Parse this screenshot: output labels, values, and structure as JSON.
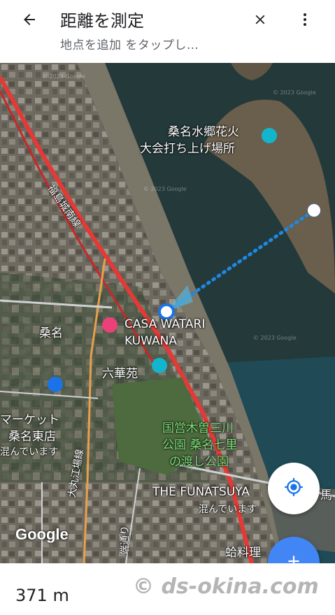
{
  "header": {
    "title": "距離を測定",
    "subtitle": "地点を追加 をタップし…"
  },
  "map": {
    "labels": {
      "fireworks_line1": "桑名水郷花火",
      "fireworks_line2": "大会打ち上げ場所",
      "road": "福島城南線",
      "kuwana": "桑名",
      "hotel_line1": "CASA WATARI",
      "hotel_line2": "KUWANA",
      "rikkaen": "六華苑",
      "park_line1": "国営木曽三川",
      "park_line2": "公園 桑名七里",
      "park_line3": "の渡し公園",
      "market_line1": "マーケット",
      "market_line2": "桑名東店",
      "market_line3": "混んでいます",
      "funatsuya": "THE FUNATSUYA",
      "funatsuya_status": "混んでいます",
      "right_edge": "馬",
      "vertical_road": "大丸江場線",
      "bottom_road": "蛤料理",
      "bottom_road2": "端通り"
    },
    "watermark": "© 2023 Google",
    "google": "Google"
  },
  "distance": "371 m",
  "credit": "© ds-okina.com",
  "colors": {
    "accent": "#4285f4",
    "water": "#233a3a",
    "route": "#e53935"
  },
  "icons": {
    "back": "back-arrow-icon",
    "close": "close-icon",
    "more": "more-vert-icon",
    "location": "my-location-icon",
    "add": "add-icon"
  }
}
